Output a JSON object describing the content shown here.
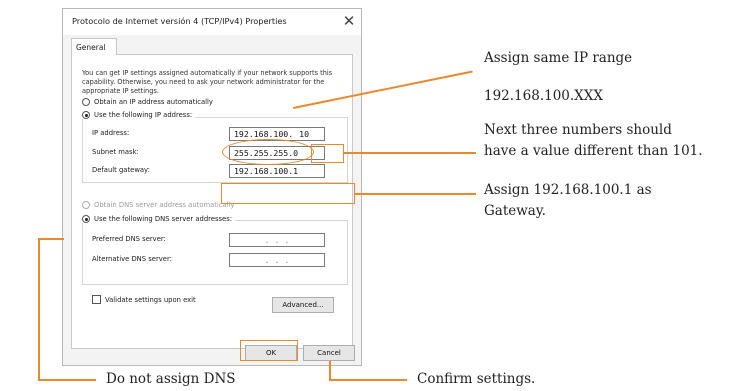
{
  "dialog": {
    "title": "Protocolo de Internet versión 4 (TCP/IPv4) Properties",
    "close_symbol": "✕",
    "tab": "General",
    "intro": "You can get IP settings assigned automatically if your network supports this capability. Otherwise, you need to ask your network administrator for the appropriate IP settings.",
    "ip_options": {
      "auto": "Obtain an IP address automatically",
      "manual": "Use the following IP address:",
      "selected": "manual"
    },
    "ip_fields": {
      "ip_label": "IP address:",
      "ip_prefix": "192.168.100.",
      "ip_last": "10",
      "mask_label": "Subnet mask:",
      "mask_value": "255.255.255.0",
      "gateway_label": "Default gateway:",
      "gateway_value": "192.168.100.1"
    },
    "dns_options": {
      "auto": "Obtain DNS server address automatically",
      "manual": "Use the following DNS server addresses:",
      "selected": "manual"
    },
    "dns_fields": {
      "preferred_label": "Preferred DNS server:",
      "alternate_label": "Alternative DNS server:",
      "empty_dots": ".    .    ."
    },
    "validate_label": "Validate settings upon exit",
    "validate_checked": false,
    "advanced_label": "Advanced...",
    "ok_label": "OK",
    "cancel_label": "Cancel"
  },
  "annotations": {
    "ip_range_1": "Assign same IP range",
    "ip_range_2": "192.168.100.XXX",
    "next_three_1": "Next three numbers should",
    "next_three_2": "have a value different than 101.",
    "gateway_1": "Assign 192.168.100.1 as",
    "gateway_2": "Gateway.",
    "dns": "Do not assign DNS",
    "confirm": "Confirm settings.",
    "color": "#e8892c"
  }
}
